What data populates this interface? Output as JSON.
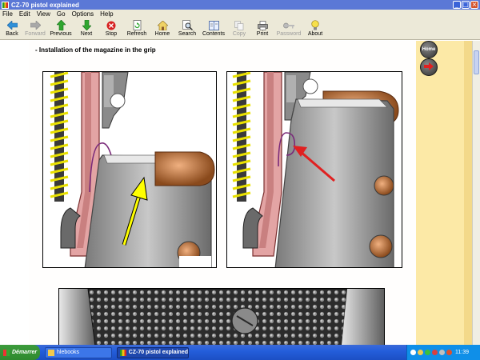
{
  "window": {
    "title": "CZ-70 pistol explained",
    "controls": [
      "_",
      "□",
      "×"
    ]
  },
  "menu": [
    "File",
    "Edit",
    "View",
    "Go",
    "Options",
    "Help"
  ],
  "toolbar": {
    "back": "Back",
    "forward": "Forward",
    "previous": "Previous",
    "next": "Next",
    "stop": "Stop",
    "refresh": "Refresh",
    "home": "Home",
    "search": "Search",
    "contents": "Contents",
    "copy": "Copy",
    "print": "Print",
    "password": "Password",
    "about": "About"
  },
  "content": {
    "section_title": "- Installation of the magazine in the grip"
  },
  "side_buttons": {
    "home_label": "Home"
  },
  "taskbar": {
    "start": "Démarrer",
    "tasks": [
      "hlebooks",
      "CZ-70 pistol explained"
    ],
    "clock": "11:39"
  },
  "colors": {
    "titlebar": "#5b78d6",
    "chrome": "#ece9d8",
    "side_panel": "#fce9a6",
    "taskbar": "#245edb",
    "arrow_yellow": "#ffff00",
    "arrow_red": "#e02020"
  }
}
